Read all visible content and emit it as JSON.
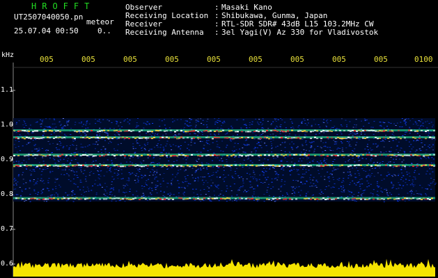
{
  "header": {
    "brand": "HROFFT",
    "file_name": "UT2507040050.pn",
    "file_suffix": "meteor",
    "datetime": "25.07.04 00:50",
    "datetime_extra": "0.."
  },
  "info": [
    {
      "label": "Observer",
      "sep": ":",
      "value": "Masaki Kano"
    },
    {
      "label": "Receiving Location",
      "sep": ":",
      "value": "Shibukawa, Gunma, Japan"
    },
    {
      "label": "Receiver",
      "sep": ":",
      "value": "RTL-SDR SDR# 43dB L15 103.2MHz CW"
    },
    {
      "label": "Receiving Antenna",
      "sep": ":",
      "value": "3el Yagi(V) Az 330 for Vladivostok"
    }
  ],
  "chart_data": {
    "type": "heatmap",
    "ylabel": "kHz",
    "y_ticks": [
      "1.1",
      "1.0",
      "0.9",
      "0.8",
      "0.7",
      "0.6"
    ],
    "x_ticks": [
      "005",
      "005",
      "005",
      "005",
      "005",
      "005",
      "005",
      "005",
      "005",
      "0100"
    ],
    "ylim": [
      0.6,
      1.15
    ],
    "signal_band_khz": [
      0.78,
      1.02
    ],
    "strong_lines_khz": [
      0.985,
      0.965,
      0.915,
      0.885,
      0.79
    ],
    "colors": {
      "background": "#000000",
      "noise": "#1040ff",
      "strong": "#ff3030",
      "medium": "#30ffa0",
      "meter": "#f5e400",
      "tick_label": "#e8e03a",
      "brand": "#22dd22"
    }
  }
}
